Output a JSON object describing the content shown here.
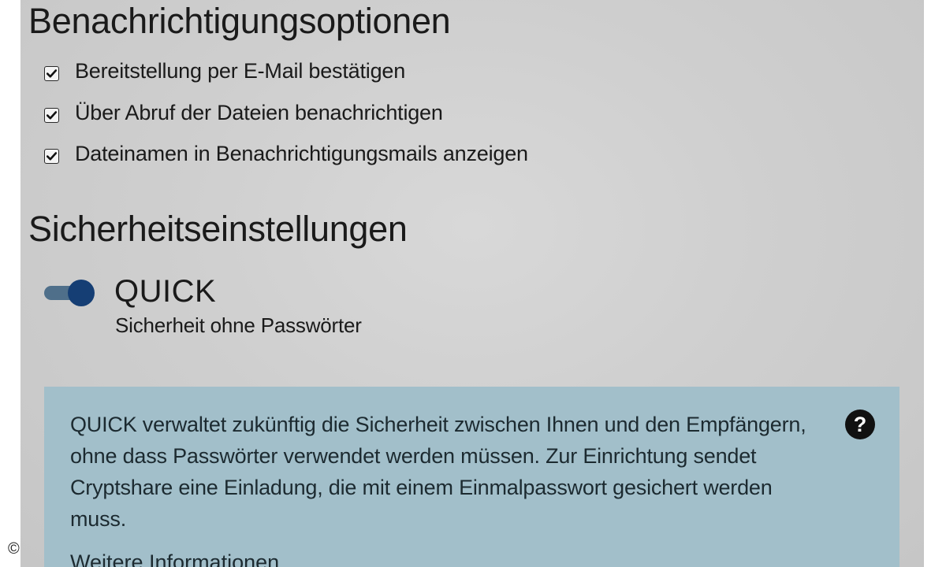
{
  "notifications": {
    "heading": "Benachrichtigungsoptionen",
    "options": [
      {
        "label": "Bereitstellung per E-Mail bestätigen",
        "checked": true
      },
      {
        "label": "Über Abruf der Dateien benachrichtigen",
        "checked": true
      },
      {
        "label": "Dateinamen in Benachrichtigungsmails anzeigen",
        "checked": true
      }
    ]
  },
  "security": {
    "heading": "Sicherheitseinstellungen",
    "quick": {
      "enabled": true,
      "title": "QUICK",
      "subtitle": "Sicherheit ohne Passwörter"
    },
    "info": {
      "text": "QUICK verwaltet zukünftig die Sicherheit zwischen Ihnen und den Empfängern, ohne dass Passwörter verwendet werden müssen. Zur Einrichtung sendet Cryptshare eine Einladung, die mit einem Einmalpasswort gesichert werden muss.",
      "more_link": "Weitere Informationen",
      "help_icon": "question-circle-icon"
    }
  },
  "colors": {
    "panel_background": "#cfcfcf",
    "info_box_background": "#a2bfca",
    "toggle_knob": "#153e74",
    "toggle_track": "#4f6f8a"
  },
  "copyright_symbol": "©"
}
